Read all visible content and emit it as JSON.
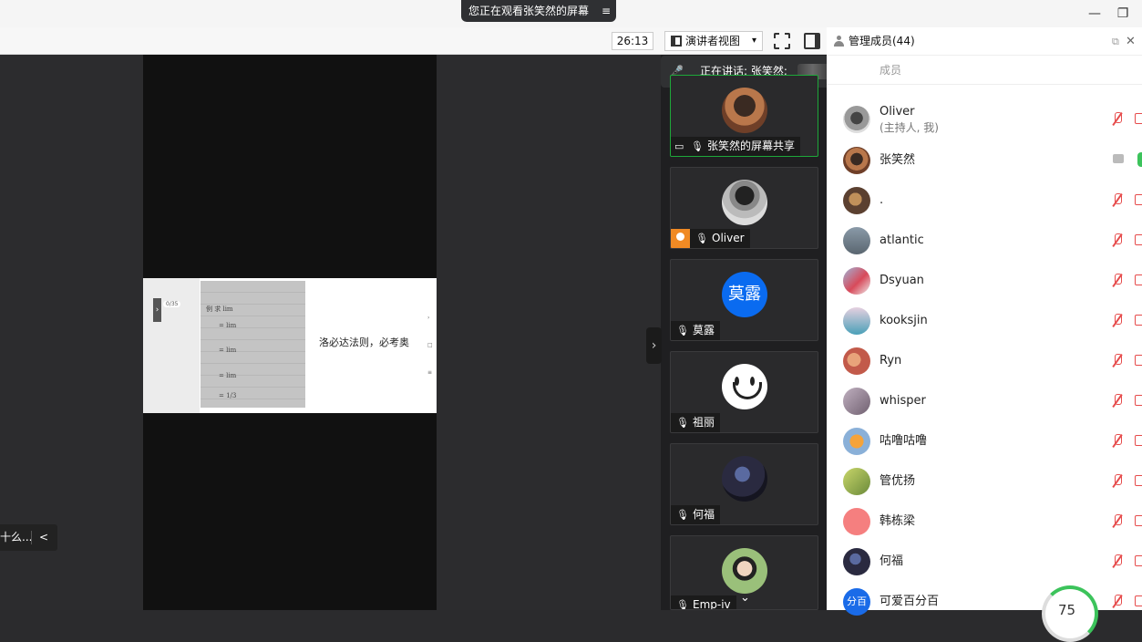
{
  "window": {
    "viewing_text": "您正在观看张笑然的屏幕",
    "menu_icon": "≡",
    "minimize": "—",
    "restore": "❐"
  },
  "toolbar": {
    "timer": "26:13",
    "speaker_view_label": "演讲者视图",
    "dropdown_arrow": "▾"
  },
  "stage": {
    "slide_pager": "0/35",
    "slide_caption": "洛必达法则，必考奥",
    "photo_lines": [
      "例  求 lim",
      "= lim",
      "= lim",
      "= lim",
      "= 1/3"
    ],
    "bottom_chip_text": "十么...",
    "bottom_chip_chevron": "<",
    "expand_chevron": "›"
  },
  "speaking": {
    "mic_icon": "🎤",
    "label": "正在讲话: 张笑然;",
    "back_icon": "↶"
  },
  "video_tiles": [
    {
      "name": "张笑然的屏幕共享",
      "share": true
    },
    {
      "name": "Oliver",
      "host": true
    },
    {
      "name": "莫露",
      "avatar_text": "莫露"
    },
    {
      "name": "祖丽"
    },
    {
      "name": "何福"
    },
    {
      "name": "Emp-iv"
    }
  ],
  "panel": {
    "title": "管理成员(44)",
    "search_placeholder": "成员",
    "close_icon": "✕",
    "popout_icon": "⧉",
    "members": [
      {
        "name": "Oliver",
        "sub": "(主持人, 我)"
      },
      {
        "name": "张笑然"
      },
      {
        "name": "."
      },
      {
        "name": "atlantic"
      },
      {
        "name": "Dsyuan"
      },
      {
        "name": "kooksjin"
      },
      {
        "name": "Ryn"
      },
      {
        "name": "whisper"
      },
      {
        "name": "咕噜咕噜"
      },
      {
        "name": "管优扬"
      },
      {
        "name": "韩栋梁"
      },
      {
        "name": "何福"
      },
      {
        "name": "可爱百分百",
        "avatar_text": "分百"
      }
    ]
  },
  "progress": {
    "value": "75"
  },
  "colors": {
    "accent_green": "#1ea83a",
    "mute_red": "#e64b4b",
    "avatar_blue": "#0a6bf0"
  }
}
